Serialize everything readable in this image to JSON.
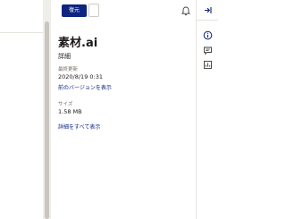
{
  "toolbar": {
    "restore_label": "復元",
    "icons": [
      "bell-icon",
      "collapse-panel-icon"
    ]
  },
  "details": {
    "file_name": "素材.ai",
    "section_title": "詳細",
    "last_updated_label": "最終更新",
    "last_updated_value": "2020/8/19 0:31",
    "previous_version_link": "前のバージョンを表示",
    "size_label": "サイズ",
    "size_value": "1.58 MB",
    "show_all_link": "詳細をすべて表示"
  },
  "rail": {
    "icons": [
      "info-icon",
      "comment-icon",
      "activity-icon"
    ]
  },
  "colors": {
    "accent": "#0d2481",
    "text": "#1e1919",
    "muted": "#736c64"
  }
}
